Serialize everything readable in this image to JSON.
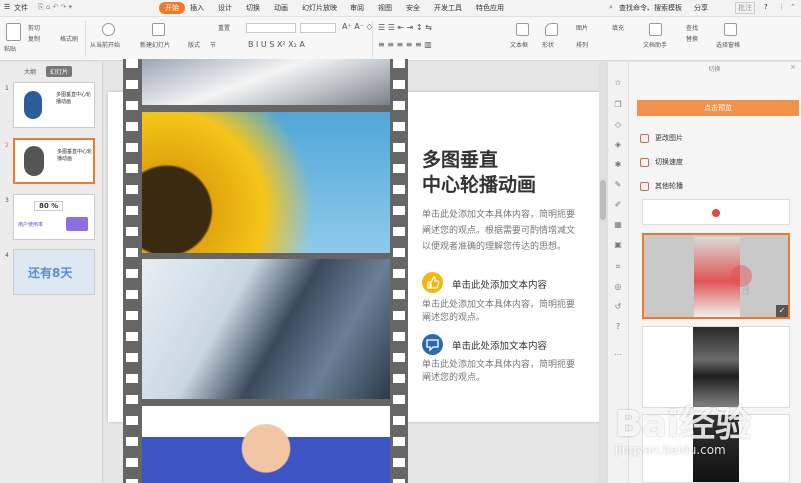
{
  "menubar": {
    "file": "文件",
    "tabs": [
      "开始",
      "插入",
      "设计",
      "切换",
      "动画",
      "幻灯片放映",
      "审阅",
      "视图",
      "安全",
      "开发工具",
      "特色应用"
    ],
    "search": "查找命令、搜索模板",
    "share": "分享",
    "comment": "批注",
    "help": "?"
  },
  "ribbon": {
    "paste": "粘贴",
    "cut": "剪切",
    "copy": "复制",
    "format_painter": "格式刷",
    "from_start": "从当前开始",
    "new_slide": "新建幻灯片",
    "layout": "版式",
    "section": "节",
    "reset": "重置",
    "textbox": "文本框",
    "shape": "形状",
    "arrange": "排列",
    "picture": "图片",
    "fill": "填充",
    "find": "查找",
    "replace": "替换",
    "text_tools": "文档助手",
    "select_pane": "选择窗格"
  },
  "leftpane": {
    "tab_outline": "大纲",
    "tab_slides": "幻灯片",
    "slides": [
      {
        "num": "1",
        "text": "多图垂直中心轮播动画"
      },
      {
        "num": "2",
        "text": "多图垂直中心轮播动画"
      },
      {
        "num": "3",
        "text": "80 %",
        "sub": "用户使用率"
      },
      {
        "num": "4",
        "text": "还有8天"
      }
    ]
  },
  "slide": {
    "title_line1": "多图垂直",
    "title_line2": "中心轮播动画",
    "body_line1": "单击此处添加文本具体内容，简明扼要",
    "body_line2": "阐述您的观点。根据需要可酌情增减文",
    "body_line3": "以便观者准确的理解您传达的思想。",
    "bullet1_head": "单击此处添加文本内容",
    "bullet1_line1": "单击此处添加文本具体内容，简明扼要",
    "bullet1_line2": "阐述您的观点。",
    "bullet2_head": "单击此处添加文本内容",
    "bullet2_line1": "单击此处添加文本具体内容，简明扼要",
    "bullet2_line2": "阐述您的观点。",
    "colors": {
      "accent1": "#f2b90c",
      "accent2": "#2b6cb0"
    }
  },
  "rightpane": {
    "title": "切换",
    "preview_button": "点击预览",
    "options": [
      "更改图片",
      "切换速度",
      "其他轮播"
    ]
  },
  "watermark": {
    "brand": "Bai经验",
    "url": "jingyan.baidu.com"
  },
  "colors": {
    "accent": "#f2792b",
    "preview": "#f2924a"
  }
}
